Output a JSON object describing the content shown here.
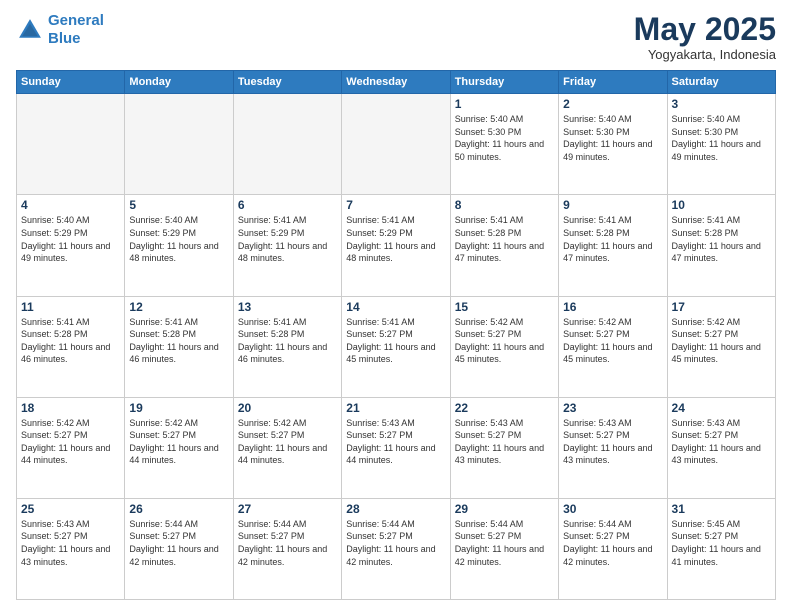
{
  "header": {
    "logo_line1": "General",
    "logo_line2": "Blue",
    "month": "May 2025",
    "location": "Yogyakarta, Indonesia"
  },
  "days_of_week": [
    "Sunday",
    "Monday",
    "Tuesday",
    "Wednesday",
    "Thursday",
    "Friday",
    "Saturday"
  ],
  "weeks": [
    [
      {
        "day": "",
        "empty": true
      },
      {
        "day": "",
        "empty": true
      },
      {
        "day": "",
        "empty": true
      },
      {
        "day": "",
        "empty": true
      },
      {
        "day": "1",
        "sunrise": "Sunrise: 5:40 AM",
        "sunset": "Sunset: 5:30 PM",
        "daylight": "Daylight: 11 hours and 50 minutes."
      },
      {
        "day": "2",
        "sunrise": "Sunrise: 5:40 AM",
        "sunset": "Sunset: 5:30 PM",
        "daylight": "Daylight: 11 hours and 49 minutes."
      },
      {
        "day": "3",
        "sunrise": "Sunrise: 5:40 AM",
        "sunset": "Sunset: 5:30 PM",
        "daylight": "Daylight: 11 hours and 49 minutes."
      }
    ],
    [
      {
        "day": "4",
        "sunrise": "Sunrise: 5:40 AM",
        "sunset": "Sunset: 5:29 PM",
        "daylight": "Daylight: 11 hours and 49 minutes."
      },
      {
        "day": "5",
        "sunrise": "Sunrise: 5:40 AM",
        "sunset": "Sunset: 5:29 PM",
        "daylight": "Daylight: 11 hours and 48 minutes."
      },
      {
        "day": "6",
        "sunrise": "Sunrise: 5:41 AM",
        "sunset": "Sunset: 5:29 PM",
        "daylight": "Daylight: 11 hours and 48 minutes."
      },
      {
        "day": "7",
        "sunrise": "Sunrise: 5:41 AM",
        "sunset": "Sunset: 5:29 PM",
        "daylight": "Daylight: 11 hours and 48 minutes."
      },
      {
        "day": "8",
        "sunrise": "Sunrise: 5:41 AM",
        "sunset": "Sunset: 5:28 PM",
        "daylight": "Daylight: 11 hours and 47 minutes."
      },
      {
        "day": "9",
        "sunrise": "Sunrise: 5:41 AM",
        "sunset": "Sunset: 5:28 PM",
        "daylight": "Daylight: 11 hours and 47 minutes."
      },
      {
        "day": "10",
        "sunrise": "Sunrise: 5:41 AM",
        "sunset": "Sunset: 5:28 PM",
        "daylight": "Daylight: 11 hours and 47 minutes."
      }
    ],
    [
      {
        "day": "11",
        "sunrise": "Sunrise: 5:41 AM",
        "sunset": "Sunset: 5:28 PM",
        "daylight": "Daylight: 11 hours and 46 minutes."
      },
      {
        "day": "12",
        "sunrise": "Sunrise: 5:41 AM",
        "sunset": "Sunset: 5:28 PM",
        "daylight": "Daylight: 11 hours and 46 minutes."
      },
      {
        "day": "13",
        "sunrise": "Sunrise: 5:41 AM",
        "sunset": "Sunset: 5:28 PM",
        "daylight": "Daylight: 11 hours and 46 minutes."
      },
      {
        "day": "14",
        "sunrise": "Sunrise: 5:41 AM",
        "sunset": "Sunset: 5:27 PM",
        "daylight": "Daylight: 11 hours and 45 minutes."
      },
      {
        "day": "15",
        "sunrise": "Sunrise: 5:42 AM",
        "sunset": "Sunset: 5:27 PM",
        "daylight": "Daylight: 11 hours and 45 minutes."
      },
      {
        "day": "16",
        "sunrise": "Sunrise: 5:42 AM",
        "sunset": "Sunset: 5:27 PM",
        "daylight": "Daylight: 11 hours and 45 minutes."
      },
      {
        "day": "17",
        "sunrise": "Sunrise: 5:42 AM",
        "sunset": "Sunset: 5:27 PM",
        "daylight": "Daylight: 11 hours and 45 minutes."
      }
    ],
    [
      {
        "day": "18",
        "sunrise": "Sunrise: 5:42 AM",
        "sunset": "Sunset: 5:27 PM",
        "daylight": "Daylight: 11 hours and 44 minutes."
      },
      {
        "day": "19",
        "sunrise": "Sunrise: 5:42 AM",
        "sunset": "Sunset: 5:27 PM",
        "daylight": "Daylight: 11 hours and 44 minutes."
      },
      {
        "day": "20",
        "sunrise": "Sunrise: 5:42 AM",
        "sunset": "Sunset: 5:27 PM",
        "daylight": "Daylight: 11 hours and 44 minutes."
      },
      {
        "day": "21",
        "sunrise": "Sunrise: 5:43 AM",
        "sunset": "Sunset: 5:27 PM",
        "daylight": "Daylight: 11 hours and 44 minutes."
      },
      {
        "day": "22",
        "sunrise": "Sunrise: 5:43 AM",
        "sunset": "Sunset: 5:27 PM",
        "daylight": "Daylight: 11 hours and 43 minutes."
      },
      {
        "day": "23",
        "sunrise": "Sunrise: 5:43 AM",
        "sunset": "Sunset: 5:27 PM",
        "daylight": "Daylight: 11 hours and 43 minutes."
      },
      {
        "day": "24",
        "sunrise": "Sunrise: 5:43 AM",
        "sunset": "Sunset: 5:27 PM",
        "daylight": "Daylight: 11 hours and 43 minutes."
      }
    ],
    [
      {
        "day": "25",
        "sunrise": "Sunrise: 5:43 AM",
        "sunset": "Sunset: 5:27 PM",
        "daylight": "Daylight: 11 hours and 43 minutes."
      },
      {
        "day": "26",
        "sunrise": "Sunrise: 5:44 AM",
        "sunset": "Sunset: 5:27 PM",
        "daylight": "Daylight: 11 hours and 42 minutes."
      },
      {
        "day": "27",
        "sunrise": "Sunrise: 5:44 AM",
        "sunset": "Sunset: 5:27 PM",
        "daylight": "Daylight: 11 hours and 42 minutes."
      },
      {
        "day": "28",
        "sunrise": "Sunrise: 5:44 AM",
        "sunset": "Sunset: 5:27 PM",
        "daylight": "Daylight: 11 hours and 42 minutes."
      },
      {
        "day": "29",
        "sunrise": "Sunrise: 5:44 AM",
        "sunset": "Sunset: 5:27 PM",
        "daylight": "Daylight: 11 hours and 42 minutes."
      },
      {
        "day": "30",
        "sunrise": "Sunrise: 5:44 AM",
        "sunset": "Sunset: 5:27 PM",
        "daylight": "Daylight: 11 hours and 42 minutes."
      },
      {
        "day": "31",
        "sunrise": "Sunrise: 5:45 AM",
        "sunset": "Sunset: 5:27 PM",
        "daylight": "Daylight: 11 hours and 41 minutes."
      }
    ]
  ]
}
